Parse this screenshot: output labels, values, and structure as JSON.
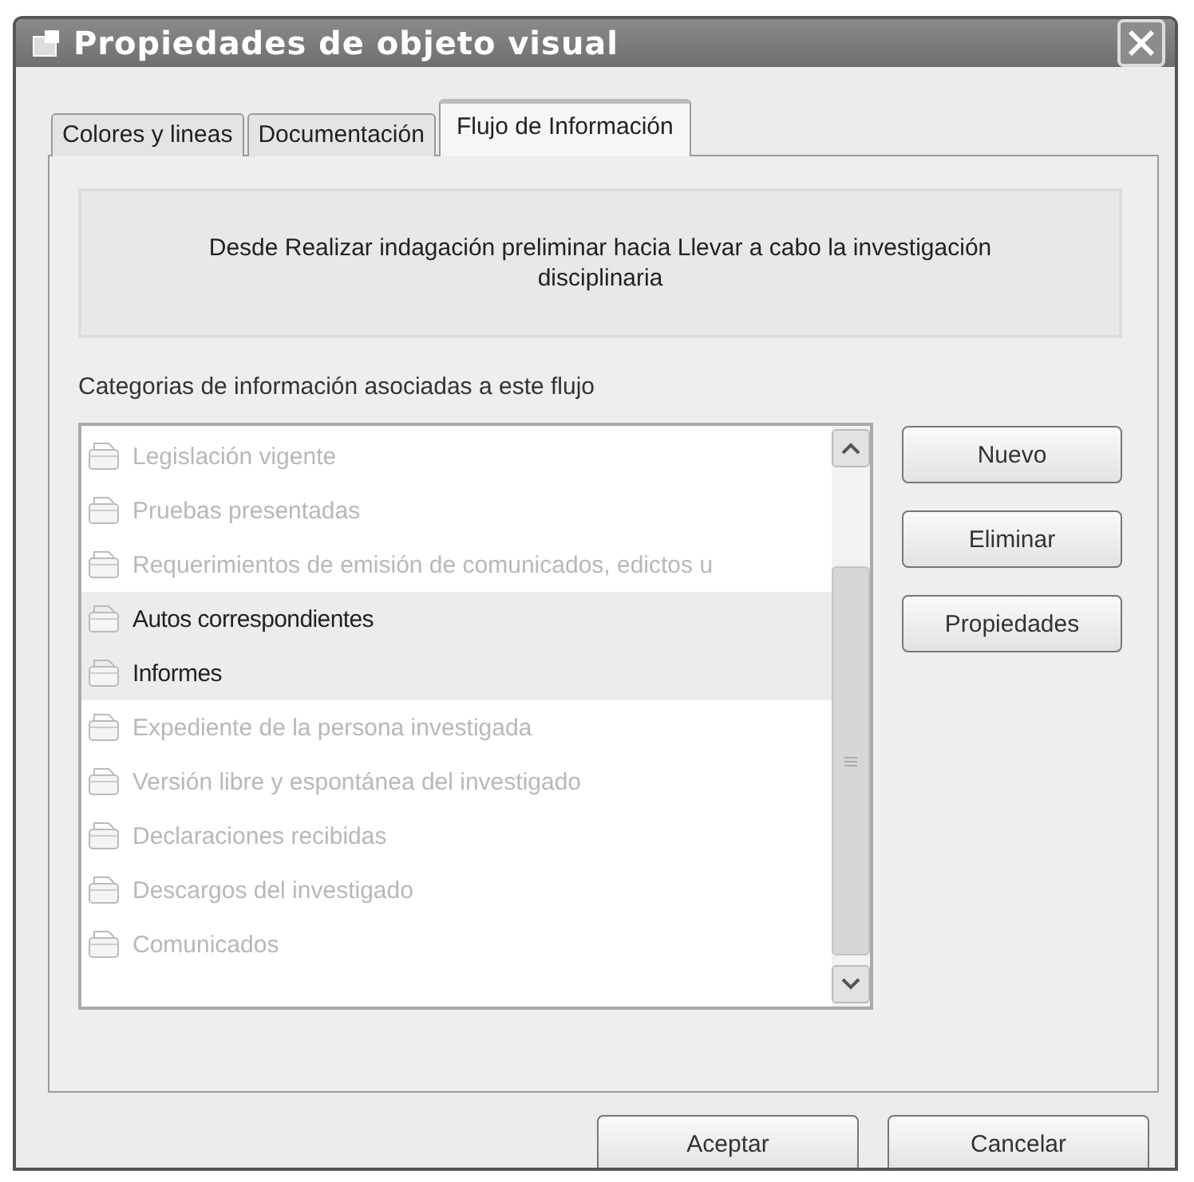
{
  "window": {
    "title": "Propiedades de objeto visual"
  },
  "tabs": [
    {
      "label": "Colores y lineas",
      "selected": false
    },
    {
      "label": "Documentación",
      "selected": false
    },
    {
      "label": "Flujo de Información",
      "selected": true
    }
  ],
  "flow_description": "Desde Realizar indagación preliminar hacia Llevar a cabo la investigación disciplinaria",
  "list_label": "Categorias de información asociadas a este flujo",
  "items": [
    {
      "label": "Legislación vigente",
      "selected": false
    },
    {
      "label": "Pruebas presentadas",
      "selected": false
    },
    {
      "label": "Requerimientos de emisión de comunicados, edictos u",
      "selected": false
    },
    {
      "label": "Autos correspondientes",
      "selected": true
    },
    {
      "label": "Informes",
      "selected": true
    },
    {
      "label": "Expediente de la persona investigada",
      "selected": false
    },
    {
      "label": "Versión libre y espontánea del investigado",
      "selected": false
    },
    {
      "label": "Declaraciones recibidas",
      "selected": false
    },
    {
      "label": "Descargos del investigado",
      "selected": false
    },
    {
      "label": "Comunicados",
      "selected": false
    }
  ],
  "side_buttons": [
    "Nuevo",
    "Eliminar",
    "Propiedades"
  ],
  "buttons": [
    "Aceptar",
    "Cancelar"
  ]
}
